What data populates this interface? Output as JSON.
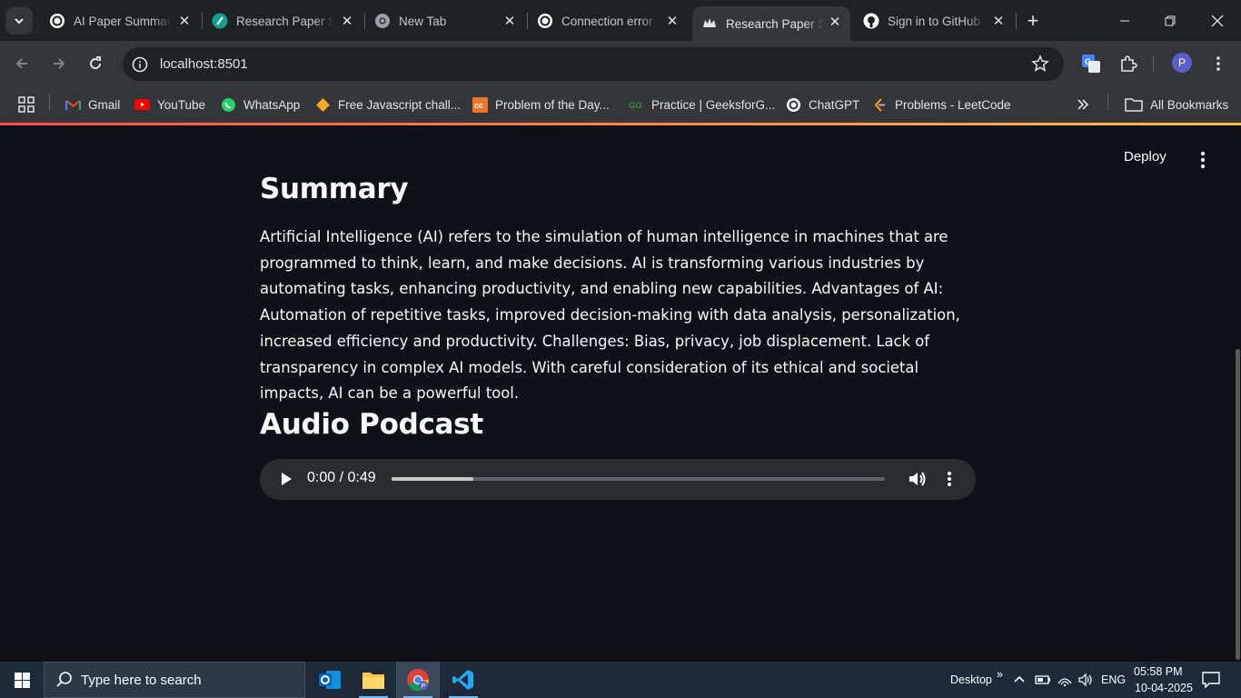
{
  "tabs": [
    {
      "title": "AI Paper Summariz",
      "icon": "chatgpt-icon"
    },
    {
      "title": "Research Paper Su",
      "icon": "feather-icon"
    },
    {
      "title": "New Tab",
      "icon": "chrome-icon"
    },
    {
      "title": "Connection error",
      "icon": "chatgpt-icon"
    },
    {
      "title": "Research Paper Su",
      "icon": "streamlit-crown-icon"
    },
    {
      "title": "Sign in to GitHub",
      "icon": "github-icon"
    }
  ],
  "active_tab_index": 4,
  "address_bar": {
    "url": "localhost:8501"
  },
  "profile": {
    "initial": "P"
  },
  "bookmarks": [
    {
      "label": "Gmail",
      "icon": "gmail-icon"
    },
    {
      "label": "YouTube",
      "icon": "youtube-icon"
    },
    {
      "label": "WhatsApp",
      "icon": "whatsapp-icon"
    },
    {
      "label": "Free Javascript chall...",
      "icon": "diamond-icon"
    },
    {
      "label": "Problem of the Day...",
      "icon": "codechef-icon"
    },
    {
      "label": "Practice | GeeksforG...",
      "icon": "gfg-icon"
    },
    {
      "label": "ChatGPT",
      "icon": "chatgpt-icon"
    },
    {
      "label": "Problems - LeetCode",
      "icon": "leetcode-icon"
    }
  ],
  "all_bookmarks_label": "All Bookmarks",
  "app": {
    "deploy_label": "Deploy",
    "summary_heading": "Summary",
    "summary_text": "Artificial Intelligence (AI) refers to the simulation of human intelligence in machines that are programmed to think, learn, and make decisions. AI is transforming various industries by automating tasks, enhancing productivity, and enabling new capabilities. Advantages of AI: Automation of repetitive tasks, improved decision-making with data analysis, personalization, increased efficiency and productivity. Challenges: Bias, privacy, job displacement. Lack of transparency in complex AI models. With careful consideration of its ethical and societal impacts, AI can be a powerful tool.",
    "audio_heading": "Audio Podcast",
    "audio_player": {
      "time_display": "0:00 / 0:49",
      "buffered_fraction": 0.165
    }
  },
  "taskbar": {
    "search_placeholder": "Type here to search",
    "apps": [
      "outlook-icon",
      "file-explorer-icon",
      "chrome-icon",
      "vscode-icon"
    ],
    "desktop_label": "Desktop",
    "language": "ENG",
    "time": "05:58 PM",
    "date": "10-04-2025"
  }
}
